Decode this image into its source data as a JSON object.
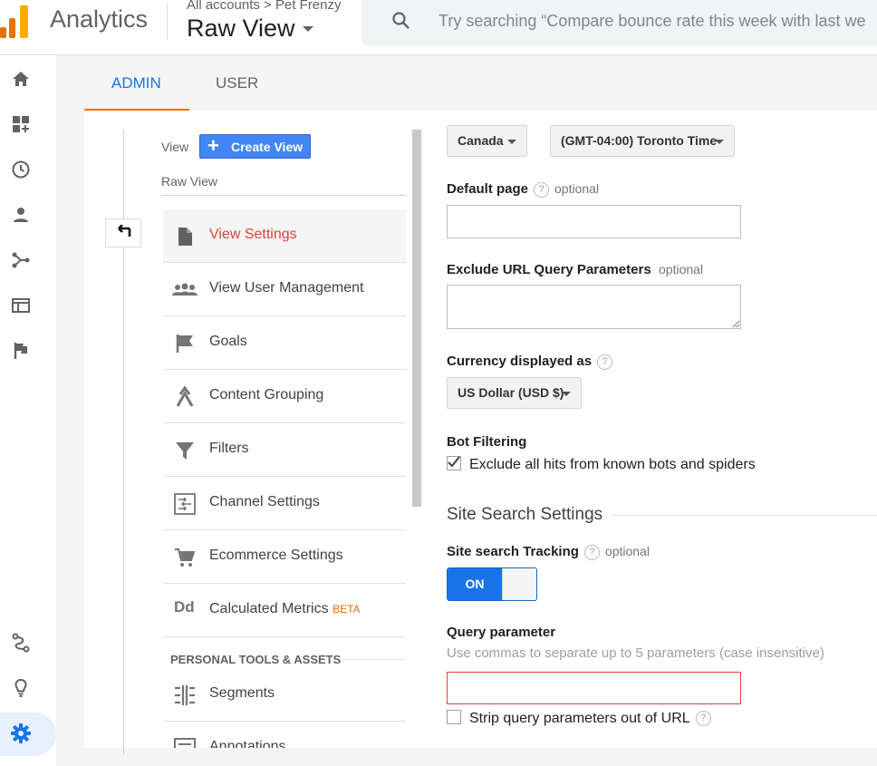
{
  "header": {
    "app_title": "Analytics",
    "breadcrumb": "All accounts > Pet Frenzy",
    "view_title": "Raw View",
    "search_placeholder": "Try searching “Compare bounce rate this week with last we"
  },
  "tabs": [
    {
      "label": "ADMIN",
      "active": true
    },
    {
      "label": "USER",
      "active": false
    }
  ],
  "nav": {
    "view_label": "View",
    "create_view_label": "Create View",
    "current_view": "Raw View",
    "items": [
      {
        "label": "View Settings",
        "icon": "document-icon",
        "active": true
      },
      {
        "label": "View User Management",
        "icon": "people-icon"
      },
      {
        "label": "Goals",
        "icon": "flag-icon"
      },
      {
        "label": "Content Grouping",
        "icon": "grouping-icon"
      },
      {
        "label": "Filters",
        "icon": "filter-icon"
      },
      {
        "label": "Channel Settings",
        "icon": "channel-icon"
      },
      {
        "label": "Ecommerce Settings",
        "icon": "cart-icon"
      },
      {
        "label": "Calculated Metrics",
        "badge": "BETA",
        "icon": "dd-icon"
      }
    ],
    "section_heading": "PERSONAL TOOLS & ASSETS",
    "personal_items": [
      {
        "label": "Segments",
        "icon": "segments-icon"
      },
      {
        "label": "Annotations",
        "icon": "annotations-icon"
      }
    ]
  },
  "form": {
    "country_value": "Canada",
    "timezone_value": "(GMT-04:00) Toronto Time",
    "default_page": {
      "label": "Default page",
      "help": "?",
      "optional": "optional",
      "value": ""
    },
    "exclude_params": {
      "label": "Exclude URL Query Parameters",
      "optional": "optional",
      "value": ""
    },
    "currency": {
      "label": "Currency displayed as",
      "help": "?",
      "value": "US Dollar (USD $)"
    },
    "bot_filtering": {
      "label": "Bot Filtering",
      "checkbox_label": "Exclude all hits from known bots and spiders",
      "checked": true
    },
    "site_search_heading": "Site Search Settings",
    "site_search_tracking": {
      "label": "Site search Tracking",
      "help": "?",
      "optional": "optional",
      "toggle_label": "ON",
      "on": true
    },
    "query_parameter": {
      "label": "Query parameter",
      "hint": "Use commas to separate up to 5 parameters (case insensitive)",
      "value": ""
    },
    "strip_params": {
      "label": "Strip query parameters out of URL",
      "help": "?",
      "checked": false
    }
  },
  "colors": {
    "accent_blue": "#4285f4",
    "toggle_blue": "#1a73e8",
    "active_red": "#db4437",
    "orange": "#e8710a",
    "beta_orange": "#e8710a"
  }
}
